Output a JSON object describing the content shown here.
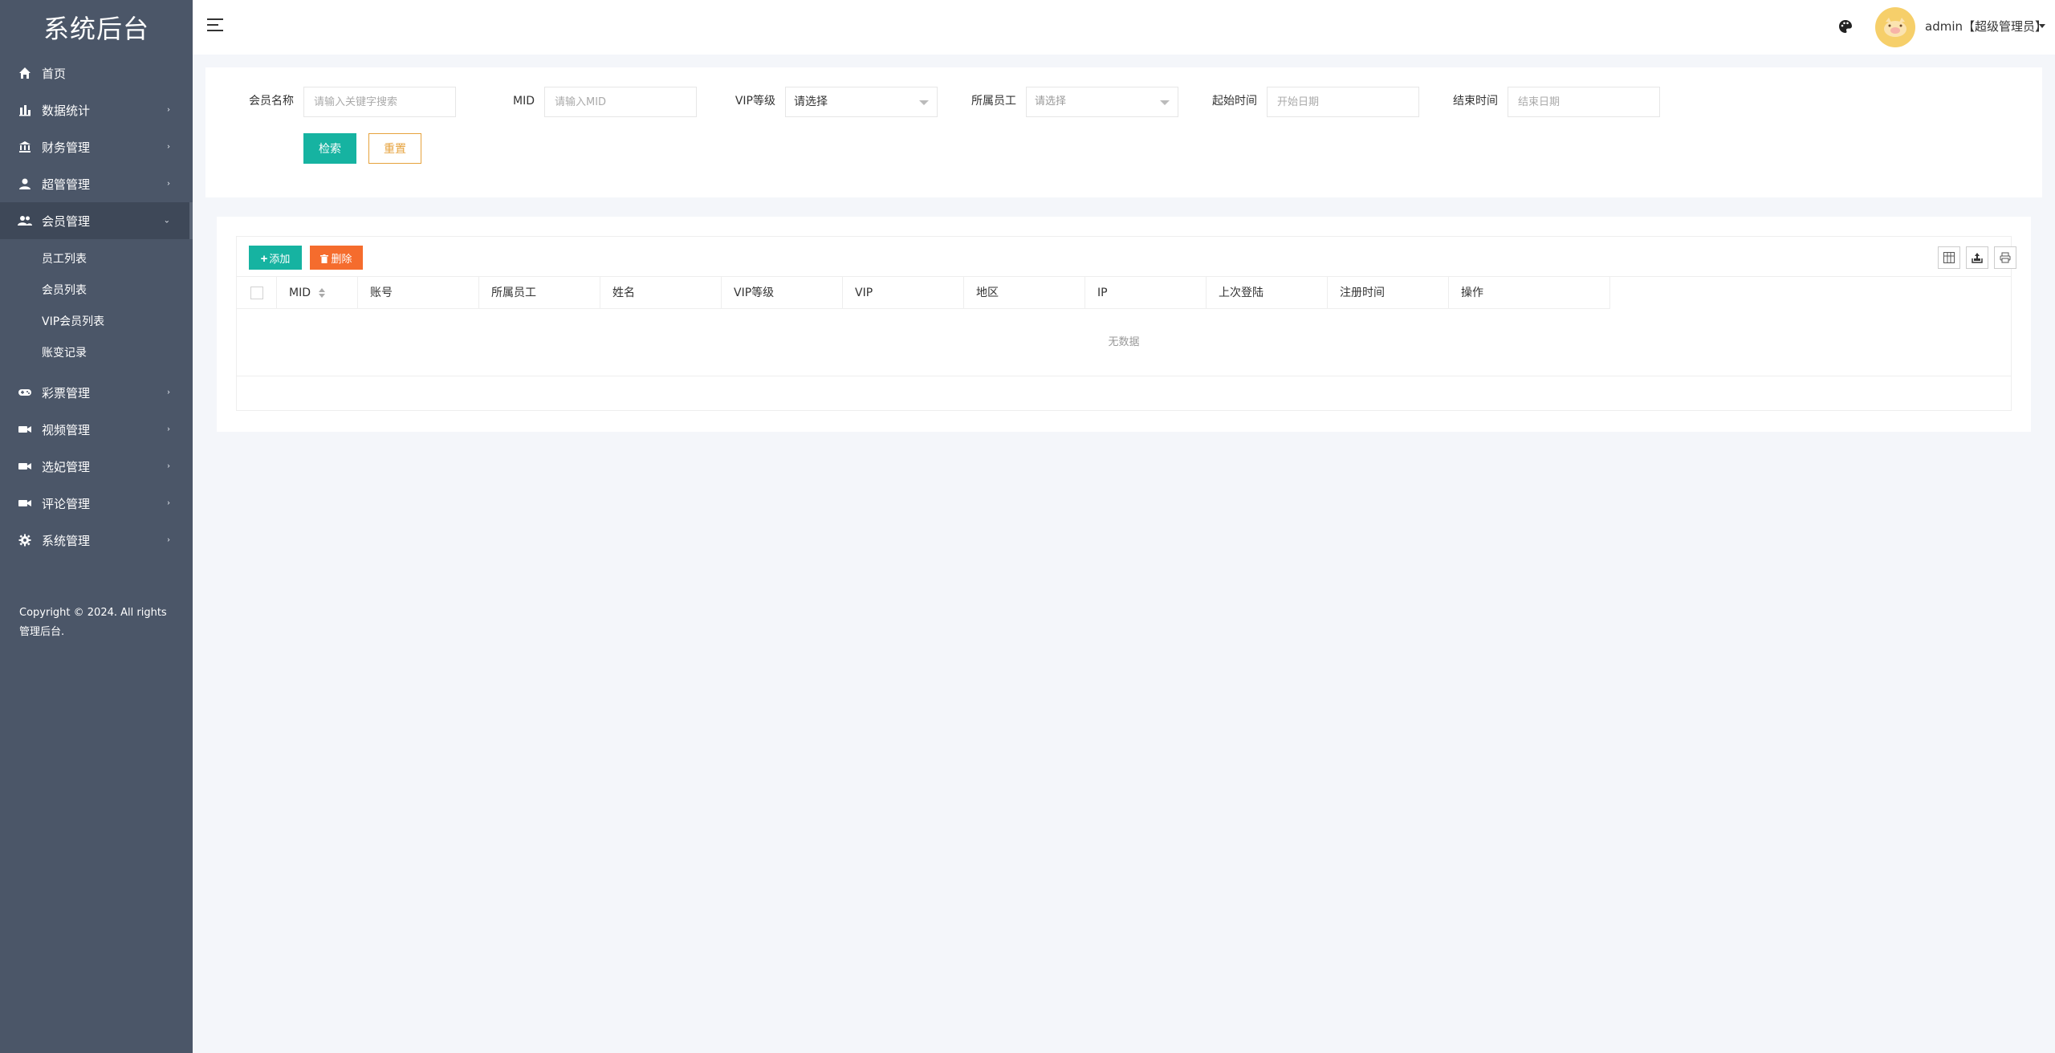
{
  "sidebar": {
    "logo": "系统后台",
    "items": [
      {
        "label": "首页",
        "icon": "home-icon"
      },
      {
        "label": "数据统计",
        "icon": "bar-chart-icon"
      },
      {
        "label": "财务管理",
        "icon": "bank-icon"
      },
      {
        "label": "超管管理",
        "icon": "user-icon"
      },
      {
        "label": "会员管理",
        "icon": "users-icon"
      },
      {
        "label": "彩票管理",
        "icon": "gamepad-icon"
      },
      {
        "label": "视频管理",
        "icon": "video-icon"
      },
      {
        "label": "选妃管理",
        "icon": "video-icon"
      },
      {
        "label": "评论管理",
        "icon": "video-icon"
      },
      {
        "label": "系统管理",
        "icon": "gear-icon"
      }
    ],
    "sub_items": [
      "员工列表",
      "会员列表",
      "VIP会员列表",
      "账变记录"
    ],
    "copyright": "Copyright © 2024. All rights 管理后台."
  },
  "header": {
    "user": "admin【超级管理员】"
  },
  "search": {
    "member_name_label": "会员名称",
    "member_name_placeholder": "请输入关键字搜索",
    "mid_label": "MID",
    "mid_placeholder": "请输入MID",
    "vip_label": "VIP等级",
    "vip_value": "请选择",
    "staff_label": "所属员工",
    "staff_value": "请选择",
    "start_label": "起始时间",
    "start_placeholder": "开始日期",
    "end_label": "结束时间",
    "end_placeholder": "结束日期",
    "search_button": "检索",
    "reset_button": "重置"
  },
  "table": {
    "add_button": "添加",
    "delete_button": "删除",
    "columns": [
      "MID",
      "账号",
      "所属员工",
      "姓名",
      "VIP等级",
      "VIP",
      "地区",
      "IP",
      "上次登陆",
      "注册时间",
      "操作"
    ],
    "empty_text": "无数据"
  },
  "colors": {
    "sidebar_bg": "#4b5668",
    "primary": "#16b3a1",
    "danger": "#f56c2d",
    "warning": "#e6a23c"
  }
}
